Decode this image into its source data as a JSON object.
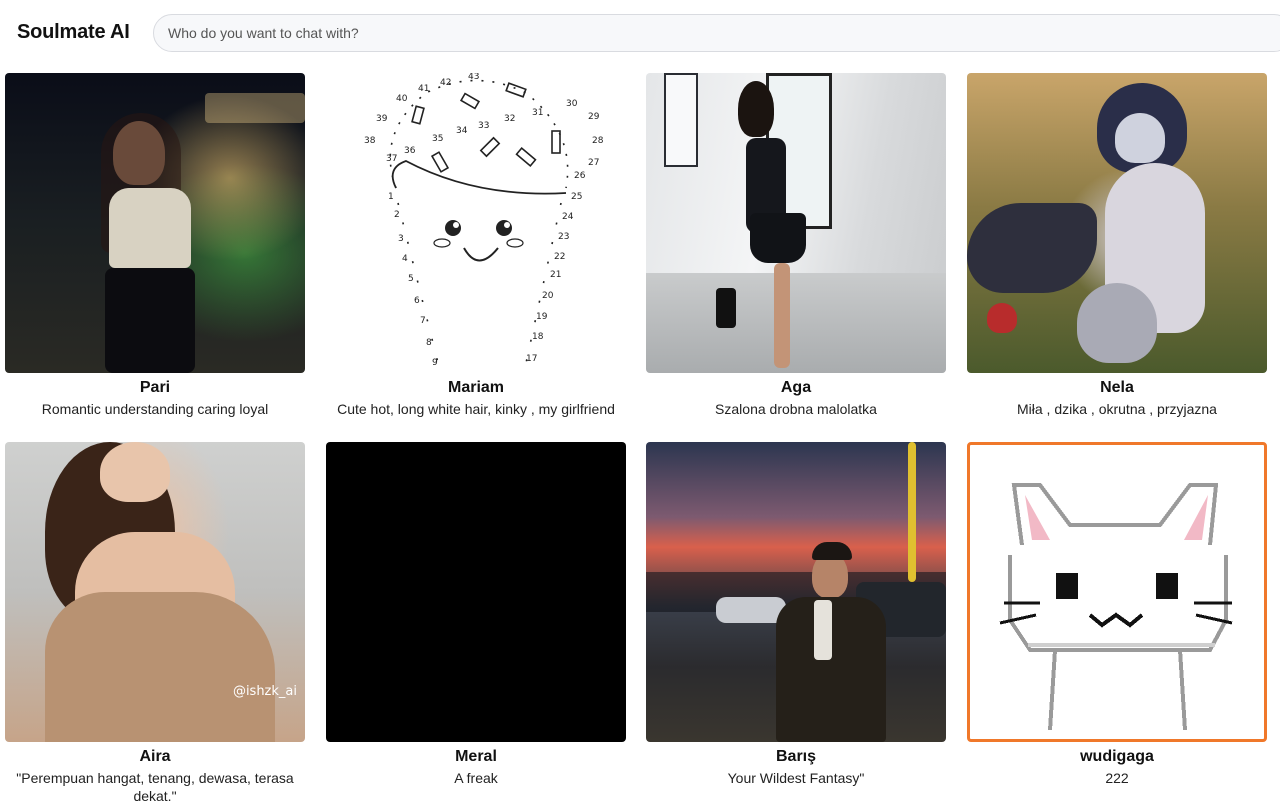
{
  "app": {
    "title": "Soulmate AI"
  },
  "search": {
    "placeholder": "Who do you want to chat with?",
    "value": ""
  },
  "characters": [
    {
      "name": "Pari",
      "description": "Romantic understanding caring loyal",
      "image": "woman-night-garden-photo"
    },
    {
      "name": "Mariam",
      "description": "Cute hot, long white hair, kinky , my girlfriend",
      "image": "connect-the-dots-icecream-drawing"
    },
    {
      "name": "Aga",
      "description": "Szalona drobna malolatka",
      "image": "woman-hallway-photo"
    },
    {
      "name": "Nela",
      "description": "Miła , dzika , okrutna , przyjazna",
      "image": "wolf-girl-forest-illustration"
    },
    {
      "name": "Aira",
      "description": "\"Perempuan hangat, tenang, dewasa, terasa dekat.\"",
      "image": "woman-sweater-photo",
      "watermark": "@ishzk_ai"
    },
    {
      "name": "Meral",
      "description": "A freak",
      "image": "black-image"
    },
    {
      "name": "Barış",
      "description": "Your Wildest Fantasy\"",
      "image": "man-sunset-street-photo"
    },
    {
      "name": "wudigaga",
      "description": "222",
      "image": "pixel-cat-drawing"
    }
  ],
  "colors": {
    "accent_border": "#f0782a",
    "search_bg": "#f7f8fa"
  }
}
